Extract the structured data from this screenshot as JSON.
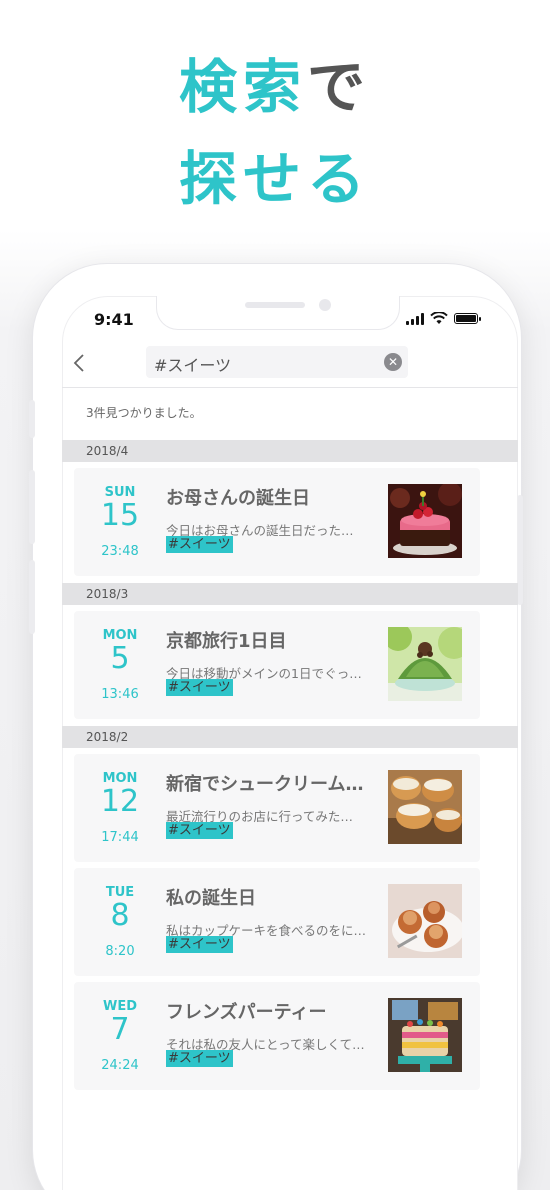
{
  "headline": {
    "line1_teal": "検索",
    "line1_gray": "で",
    "line2_teal": "探せる"
  },
  "colors": {
    "accent": "#2ec4c9",
    "text": "#555555",
    "month_bar": "#e2e2e4"
  },
  "status_bar": {
    "time": "9:41"
  },
  "search": {
    "query": "#スイーツ",
    "back_icon": "chevron-left-icon",
    "clear_icon": "clear-icon"
  },
  "results": {
    "count_text": "3件見つかりました。"
  },
  "months": [
    {
      "label": "2018/4",
      "entries": [
        {
          "dow": "SUN",
          "day": "15",
          "time": "23:48",
          "title": "お母さんの誕生日",
          "excerpt": "今日はお母さんの誕生日だった…",
          "tag": "#スイーツ"
        }
      ]
    },
    {
      "label": "2018/3",
      "entries": [
        {
          "dow": "MON",
          "day": "5",
          "time": "13:46",
          "title": "京都旅行1日目",
          "excerpt": "今日は移動がメインの1日でぐっ…",
          "tag": "#スイーツ"
        }
      ]
    },
    {
      "label": "2018/2",
      "entries": [
        {
          "dow": "MON",
          "day": "12",
          "time": "17:44",
          "title": "新宿でシュークリーム…",
          "excerpt": "最近流行りのお店に行ってみた…",
          "tag": "#スイーツ"
        },
        {
          "dow": "TUE",
          "day": "8",
          "time": "8:20",
          "title": "私の誕生日",
          "excerpt": "私はカップケーキを食べるのをに…",
          "tag": "#スイーツ"
        },
        {
          "dow": "WED",
          "day": "7",
          "time": "24:24",
          "title": "フレンズパーティー",
          "excerpt": "それは私の友人にとって楽しくて…",
          "tag": "#スイーツ"
        }
      ]
    }
  ]
}
